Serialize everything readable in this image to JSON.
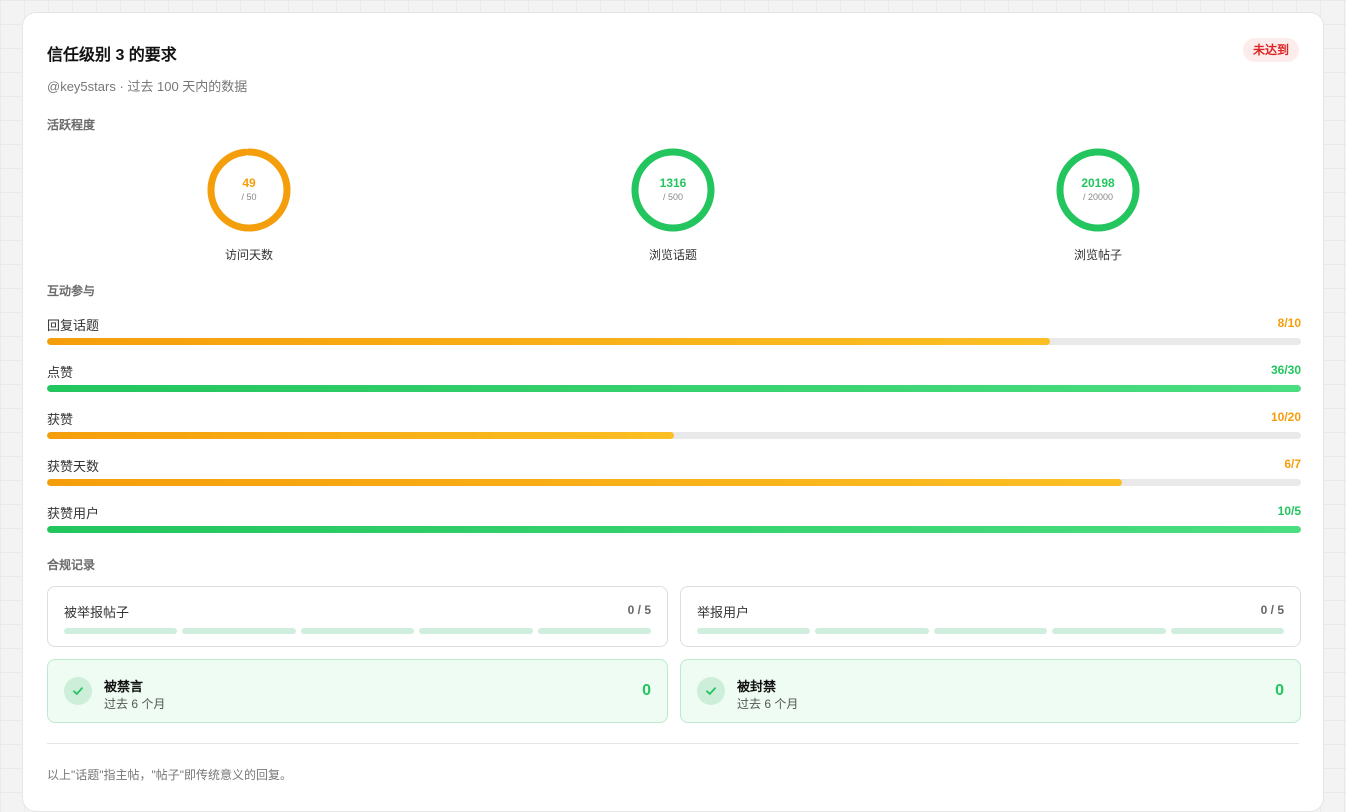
{
  "header": {
    "title": "信任级别 3 的要求",
    "status_badge": "未达到",
    "subtitle": "@key5stars · 过去 100 天内的数据"
  },
  "activity": {
    "section_title": "活跃程度",
    "rings": [
      {
        "value": "49",
        "target": "/ 50",
        "label": "访问天数",
        "ratio": 0.98,
        "color": "#f59e0b"
      },
      {
        "value": "1316",
        "target": "/ 500",
        "label": "浏览话题",
        "ratio": 1,
        "color": "#22c55e"
      },
      {
        "value": "20198",
        "target": "/ 20000",
        "label": "浏览帖子",
        "ratio": 1,
        "color": "#22c55e"
      }
    ]
  },
  "interaction": {
    "section_title": "互动参与",
    "bars": [
      {
        "label": "回复话题",
        "value": "8/10",
        "ratio": 0.8,
        "status": "warn"
      },
      {
        "label": "点赞",
        "value": "36/30",
        "ratio": 1,
        "status": "ok"
      },
      {
        "label": "获赞",
        "value": "10/20",
        "ratio": 0.5,
        "status": "warn"
      },
      {
        "label": "获赞天数",
        "value": "6/7",
        "ratio": 0.857,
        "status": "warn"
      },
      {
        "label": "获赞用户",
        "value": "10/5",
        "ratio": 1,
        "status": "ok"
      }
    ]
  },
  "compliance": {
    "section_title": "合规记录",
    "reports": [
      {
        "label": "被举报帖子",
        "value": "0 / 5",
        "segments": 5,
        "filled": 0
      },
      {
        "label": "举报用户",
        "value": "0 / 5",
        "segments": 5,
        "filled": 0
      }
    ],
    "penalties": [
      {
        "title": "被禁言",
        "subtitle": "过去 6 个月",
        "value": "0"
      },
      {
        "title": "被封禁",
        "subtitle": "过去 6 个月",
        "value": "0"
      }
    ]
  },
  "footer": {
    "note": "以上\"话题\"指主帖，\"帖子\"即传统意义的回复。"
  },
  "colors": {
    "warn": "#f59e0b",
    "ok": "#22c55e",
    "danger": "#dc2626",
    "track": "#e9e9e9"
  },
  "icons": {
    "penalty_icon": "check-icon"
  }
}
